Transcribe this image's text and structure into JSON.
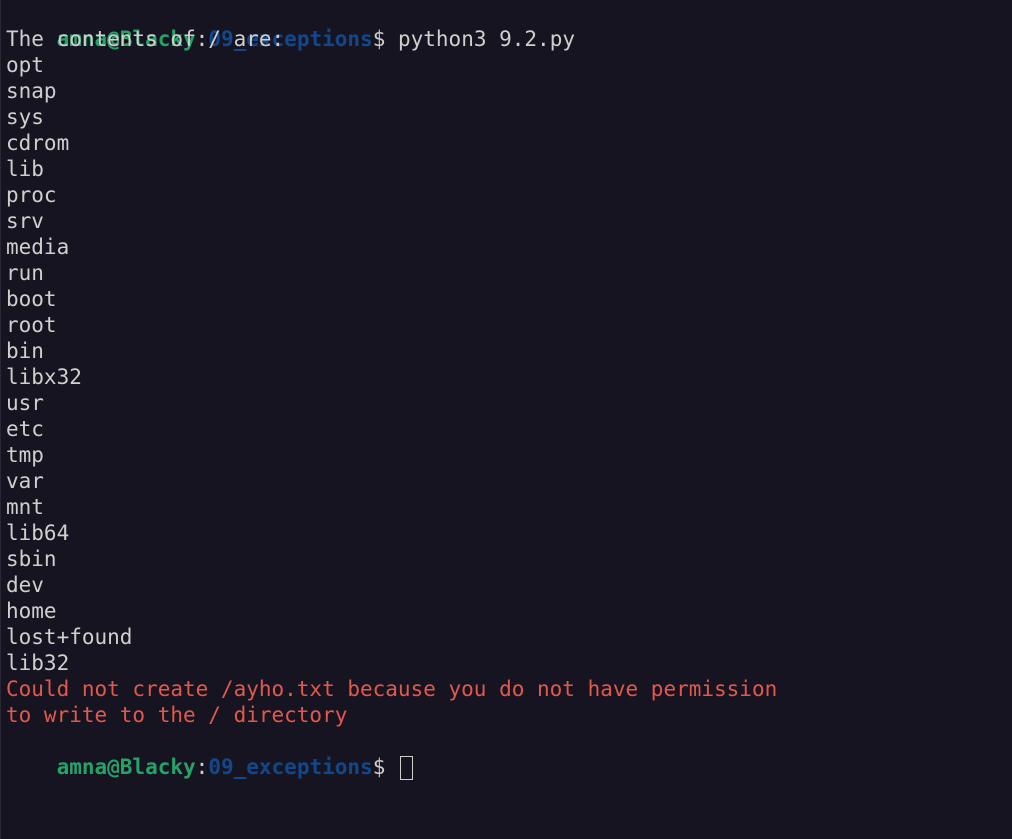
{
  "prompt": {
    "user_host": "amna@Blacky",
    "sep": ":",
    "path": "09_exceptions",
    "symbol": "$ "
  },
  "command": "python3 9.2.py",
  "header_line": "The contents of / are:",
  "entries": [
    "opt",
    "snap",
    "sys",
    "cdrom",
    "lib",
    "proc",
    "srv",
    "media",
    "run",
    "boot",
    "root",
    "bin",
    "libx32",
    "usr",
    "etc",
    "tmp",
    "var",
    "mnt",
    "lib64",
    "sbin",
    "dev",
    "home",
    "lost+found",
    "lib32"
  ],
  "error_lines": [
    "Could not create /ayho.txt because you do not have permission",
    "to write to the / directory"
  ],
  "colors": {
    "background": "#171421",
    "foreground": "#d0cfcc",
    "prompt_user": "#26a269",
    "prompt_path": "#12488b",
    "error": "#e3584c"
  }
}
